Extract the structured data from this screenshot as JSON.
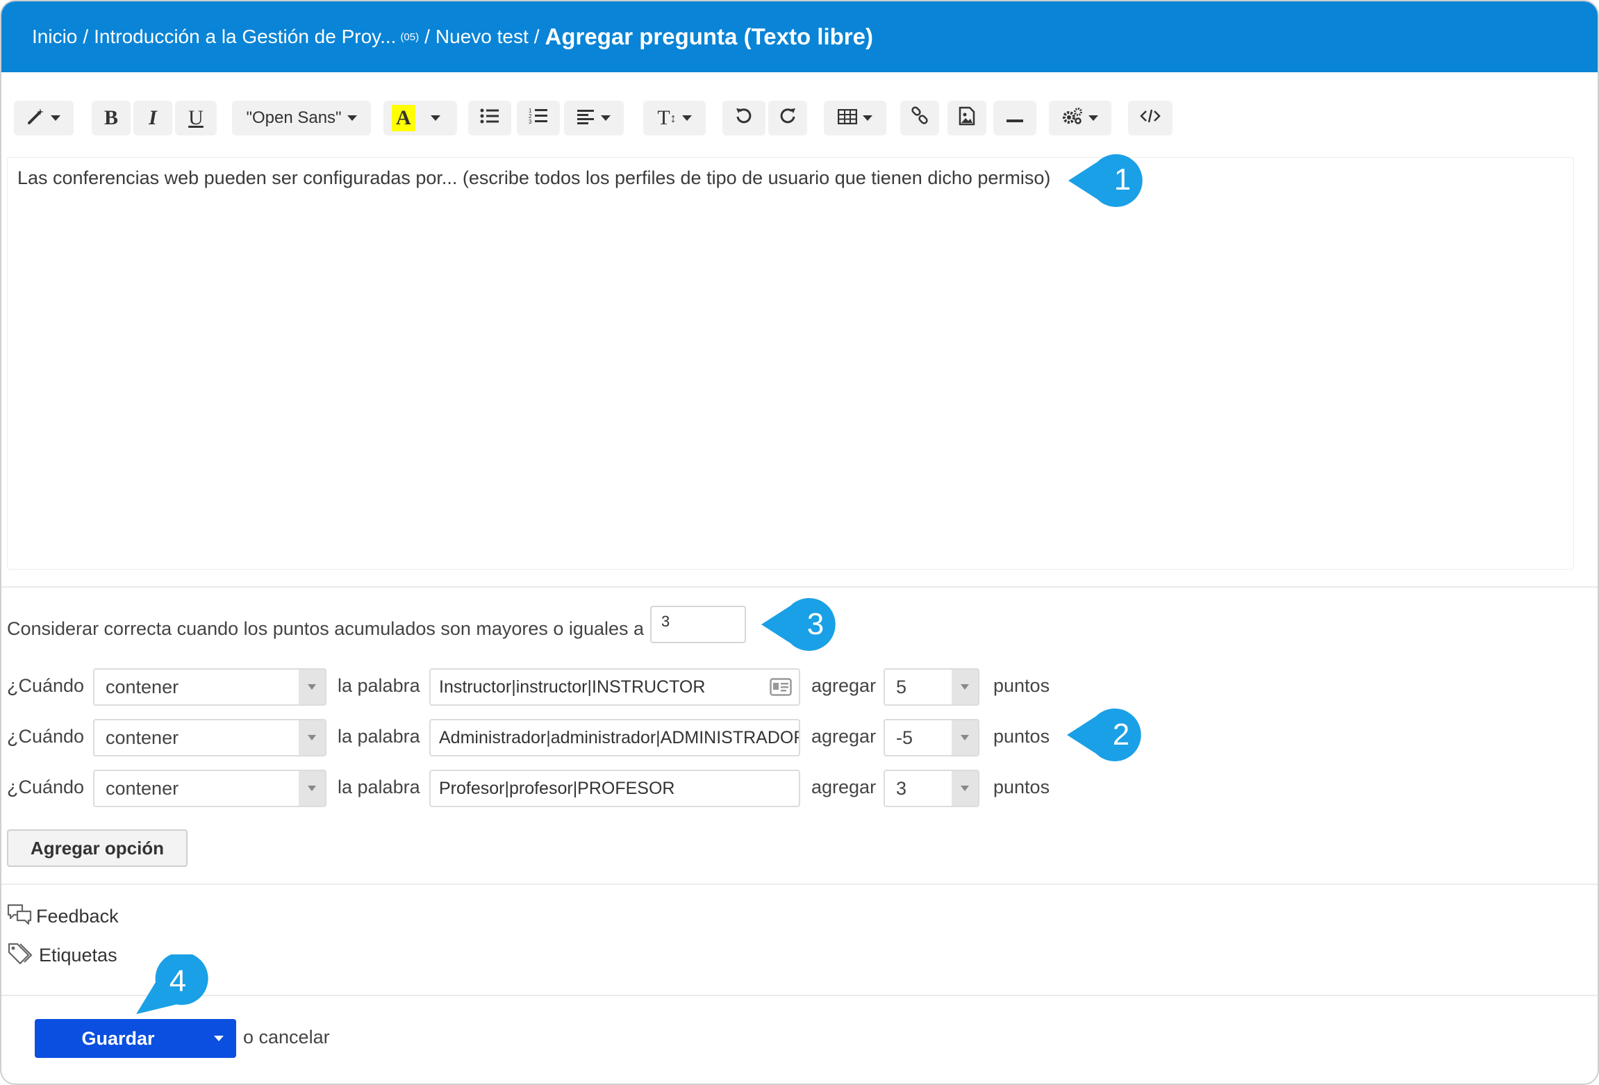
{
  "breadcrumb": {
    "home": "Inicio",
    "course": "Introducción a la Gestión de Proy...",
    "course_count": "(05)",
    "test": "Nuevo test",
    "current": "Agregar pregunta (Texto libre)",
    "separator": "/"
  },
  "toolbar": {
    "bold": "B",
    "italic": "I",
    "underline": "U",
    "font": "\"Open Sans\"",
    "color": "A",
    "font_size": "T",
    "icons": [
      "magic-wand-icon",
      "bold-icon",
      "italic-icon",
      "underline-icon",
      "font-family",
      "text-color-icon",
      "unordered-list-icon",
      "ordered-list-icon",
      "align-icon",
      "font-size-icon",
      "undo-icon",
      "redo-icon",
      "table-icon",
      "link-icon",
      "image-icon",
      "horizontal-rule-icon",
      "settings-icon",
      "code-view-icon"
    ],
    "highlight_color": "#ffff00"
  },
  "editor": {
    "content": "Las conferencias web pueden ser configuradas por... (escribe todos los perfiles de tipo de usuario que tienen dicho permiso)"
  },
  "threshold": {
    "label": "Considerar correcta cuando los puntos acumulados son mayores o iguales a",
    "value": "3"
  },
  "rules": [
    {
      "when": "¿Cuándo",
      "condition": "contener",
      "word_label": "la palabra",
      "word": "Instructor|instructor|INSTRUCTOR",
      "add": "agregar",
      "points": "5",
      "points_label": "puntos"
    },
    {
      "when": "¿Cuándo",
      "condition": "contener",
      "word_label": "la palabra",
      "word": "Administrador|administrador|ADMINISTRADOR",
      "add": "agregar",
      "points": "-5",
      "points_label": "puntos"
    },
    {
      "when": "¿Cuándo",
      "condition": "contener",
      "word_label": "la palabra",
      "word": "Profesor|profesor|PROFESOR",
      "add": "agregar",
      "points": "3",
      "points_label": "puntos"
    }
  ],
  "add_option": "Agregar opción",
  "feedback": "Feedback",
  "tags": "Etiquetas",
  "save": "Guardar",
  "cancel": "o cancelar",
  "callouts": [
    "1",
    "2",
    "3",
    "4"
  ],
  "colors": {
    "header": "#0a84d6",
    "callout": "#1aa0e6",
    "save_button": "#0b4fe0"
  }
}
